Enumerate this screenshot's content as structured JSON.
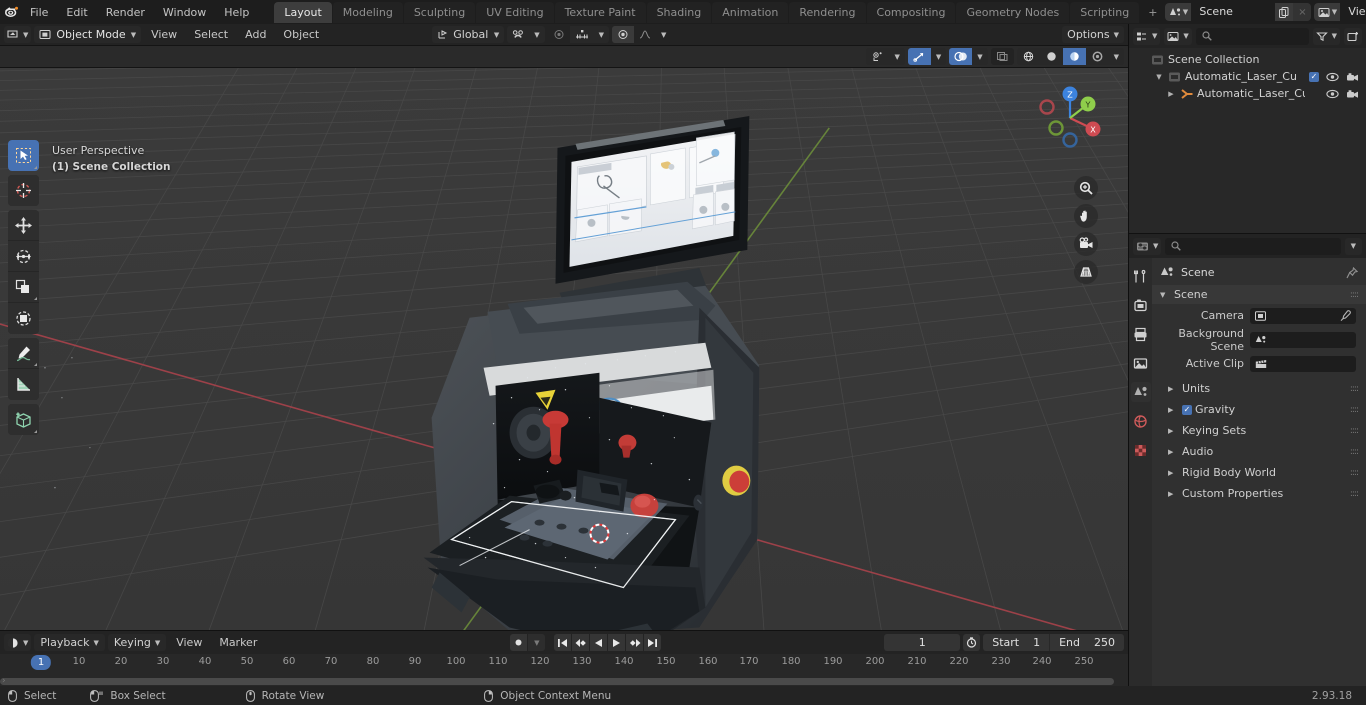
{
  "app": {
    "version": "2.93.18",
    "logo": "blender-logo"
  },
  "topbar": {
    "menus": [
      "File",
      "Edit",
      "Render",
      "Window",
      "Help"
    ],
    "workspaces": [
      {
        "label": "Layout",
        "active": true
      },
      {
        "label": "Modeling",
        "active": false
      },
      {
        "label": "Sculpting",
        "active": false
      },
      {
        "label": "UV Editing",
        "active": false
      },
      {
        "label": "Texture Paint",
        "active": false
      },
      {
        "label": "Shading",
        "active": false
      },
      {
        "label": "Animation",
        "active": false
      },
      {
        "label": "Rendering",
        "active": false
      },
      {
        "label": "Compositing",
        "active": false
      },
      {
        "label": "Geometry Nodes",
        "active": false
      },
      {
        "label": "Scripting",
        "active": false
      }
    ],
    "add_workspace": "+",
    "scene": {
      "name": "Scene",
      "new_label": "",
      "unlink_label": "×"
    },
    "view_layer": {
      "name": "View Layer",
      "new_label": "",
      "unlink_label": "×"
    }
  },
  "viewport_header": {
    "mode": "Object Mode",
    "menus": [
      "View",
      "Select",
      "Add",
      "Object"
    ],
    "transform_orientation": "Global",
    "options_label": "Options"
  },
  "viewport": {
    "perspective_label": "User Perspective",
    "collection_label": "(1) Scene Collection",
    "gizmo_axes": [
      "X",
      "Y",
      "Z"
    ],
    "colors": {
      "axis_x": "#ce4b52",
      "axis_y": "#8fce4b",
      "axis_z": "#3c83de",
      "background": "#393939",
      "grid": "#454545"
    },
    "tools": [
      {
        "name": "tweak-select-tool",
        "active": true
      },
      {
        "name": "cursor-tool",
        "active": false
      },
      {
        "name": "move-tool",
        "active": false
      },
      {
        "name": "rotate-tool",
        "active": false
      },
      {
        "name": "scale-tool",
        "active": false
      },
      {
        "name": "transform-tool",
        "active": false
      },
      {
        "name": "annotate-tool",
        "active": false
      },
      {
        "name": "measure-tool",
        "active": false
      },
      {
        "name": "add-cube-tool",
        "active": false
      }
    ],
    "nav_buttons": [
      "zoom-icon",
      "pan-hand-icon",
      "camera-icon",
      "ortho-persp-icon"
    ]
  },
  "outliner": {
    "display_mode": "view-layer-icon",
    "filter_icon": "filter-icon",
    "new_collection_icon": "new-collection-icon",
    "search_placeholder": "",
    "rows": [
      {
        "name": "Scene Collection",
        "indent": 0,
        "icon": "collection-icon",
        "expanded": null,
        "checkbox": false,
        "eye": false,
        "camera": false
      },
      {
        "name": "Automatic_Laser_Cut_Key_Mà",
        "indent": 1,
        "icon": "collection-icon",
        "expanded": true,
        "checkbox": true,
        "eye": true,
        "camera": true
      },
      {
        "name": "Automatic_Laser_Cut_Ke",
        "indent": 2,
        "icon": "mesh-object-icon",
        "expanded": false,
        "checkbox": false,
        "eye": true,
        "camera": true
      }
    ]
  },
  "properties": {
    "search_placeholder": "",
    "tabs": [
      {
        "name": "tool-tab",
        "icon": "wrench-screwdriver-icon",
        "active": false
      },
      {
        "name": "render-tab",
        "icon": "camera-back-icon",
        "active": false
      },
      {
        "name": "output-tab",
        "icon": "printer-icon",
        "active": false
      },
      {
        "name": "view-layer-tab",
        "icon": "images-icon",
        "active": false
      },
      {
        "name": "scene-tab",
        "icon": "scene-cone-icon",
        "active": true
      },
      {
        "name": "world-tab",
        "icon": "world-globe-icon",
        "active": false
      },
      {
        "name": "texture-tab",
        "icon": "checker-texture-icon",
        "active": false
      }
    ],
    "breadcrumb": "Scene",
    "panel_title": "Scene",
    "fields": [
      {
        "label": "Camera",
        "value": "",
        "icon": "camera-data-icon",
        "has_eyedropper": true
      },
      {
        "label": "Background Scene",
        "value": "",
        "icon": "scene-cone-icon",
        "has_eyedropper": false
      },
      {
        "label": "Active Clip",
        "value": "",
        "icon": "movie-clip-icon",
        "has_eyedropper": false
      }
    ],
    "panels": [
      {
        "label": "Units",
        "expanded": false,
        "checkbox": null
      },
      {
        "label": "Gravity",
        "expanded": false,
        "checkbox": true
      },
      {
        "label": "Keying Sets",
        "expanded": false,
        "checkbox": null
      },
      {
        "label": "Audio",
        "expanded": false,
        "checkbox": null
      },
      {
        "label": "Rigid Body World",
        "expanded": false,
        "checkbox": null
      },
      {
        "label": "Custom Properties",
        "expanded": false,
        "checkbox": null
      }
    ]
  },
  "timeline": {
    "editor_icon": "timeline-icon",
    "menus": [
      "Playback",
      "Keying",
      "View",
      "Marker"
    ],
    "record_icon": "record-icon",
    "playback_buttons": [
      "jump-to-start-icon",
      "jump-prev-keyframe-icon",
      "play-reverse-icon",
      "play-icon",
      "jump-next-keyframe-icon",
      "jump-to-end-icon"
    ],
    "current_frame": "1",
    "auto_key_icon": "stopwatch-icon",
    "start_label": "Start",
    "start_value": "1",
    "end_label": "End",
    "end_value": "250",
    "playhead_frame": "1",
    "ruler_ticks": [
      "10",
      "20",
      "30",
      "40",
      "50",
      "60",
      "70",
      "80",
      "90",
      "100",
      "110",
      "120",
      "130",
      "140",
      "150",
      "160",
      "170",
      "180",
      "190",
      "200",
      "210",
      "220",
      "230",
      "240",
      "250"
    ]
  },
  "statusbar": {
    "items": [
      {
        "icon": "mouse-left-icon",
        "label": "Select"
      },
      {
        "icon": "mouse-left-drag-icon",
        "label": "Box Select"
      },
      {
        "icon": "mouse-middle-icon",
        "label": "Rotate View"
      },
      {
        "icon": "mouse-right-icon",
        "label": "Object Context Menu"
      }
    ],
    "version": "2.93.18"
  }
}
